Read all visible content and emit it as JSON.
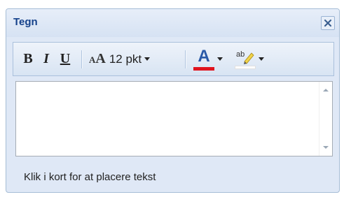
{
  "panel": {
    "title": "Tegn"
  },
  "toolbar": {
    "bold_label": "B",
    "italic_label": "I",
    "underline_label": "U",
    "font_size_label": "12 pkt",
    "font_color": "#e0141e",
    "highlight_color": "#ffffff"
  },
  "editor": {
    "value": ""
  },
  "footer": {
    "hint": "Klik i kort for at placere tekst"
  }
}
